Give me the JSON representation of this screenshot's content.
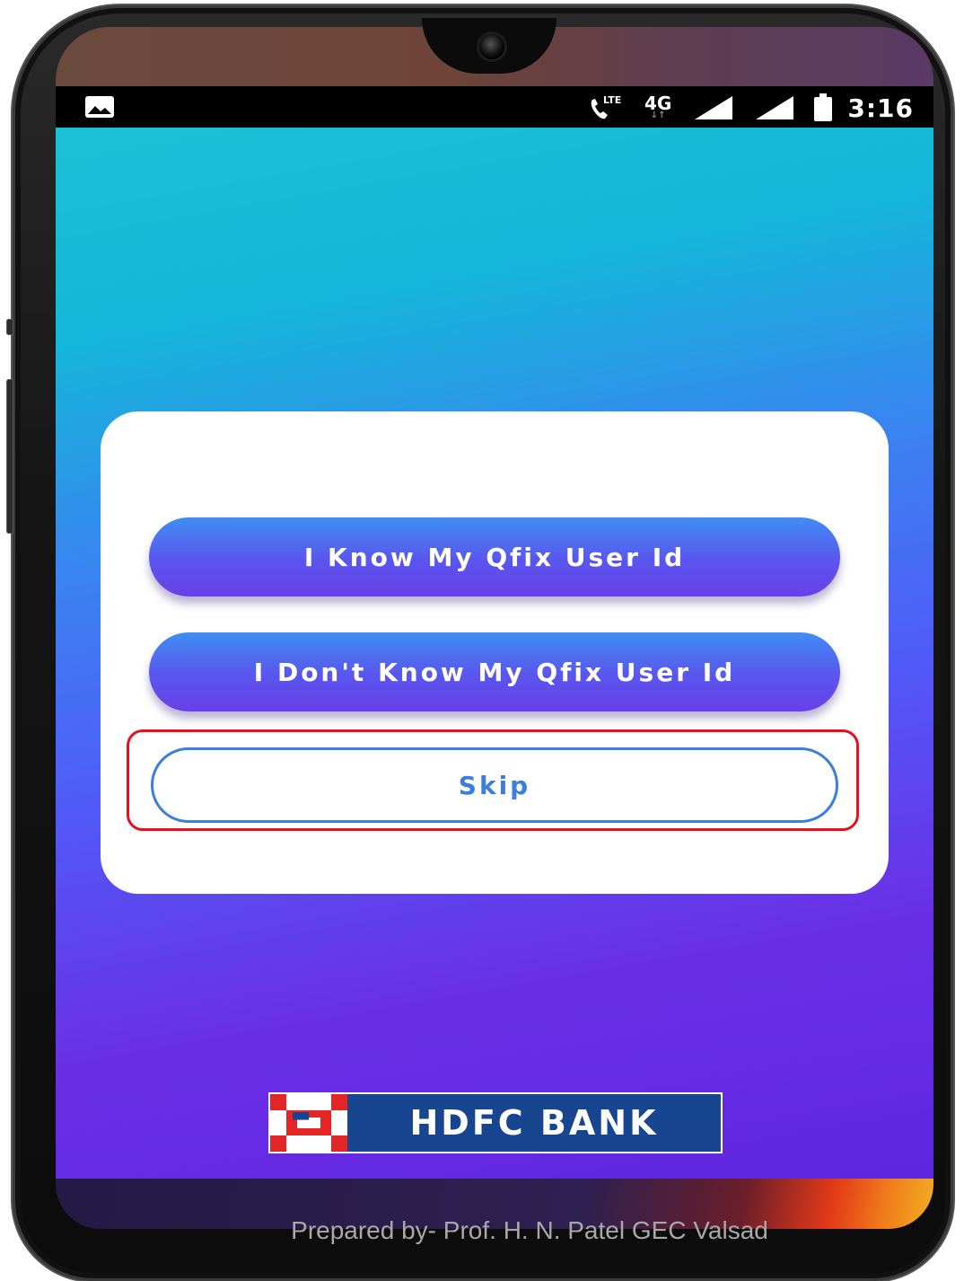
{
  "status_bar": {
    "left_icon": "image-notification-icon",
    "icons": [
      "lte-call-icon",
      "4g-data-icon",
      "signal-icon",
      "signal-icon",
      "battery-icon"
    ],
    "network_call_label": "LTE",
    "network_label": "4G",
    "time": "3:16"
  },
  "dialog": {
    "buttons": [
      {
        "label": "I Know My Qfix User Id"
      },
      {
        "label": "I Don't Know My Qfix User Id"
      },
      {
        "label": "Skip"
      }
    ]
  },
  "footer": {
    "brand_text": "HDFC BANK",
    "brand_colors": {
      "blue": "#17458f",
      "red": "#e32526"
    }
  },
  "caption": "Prepared by- Prof. H. N. Patel GEC Valsad",
  "colors": {
    "button_blue": "#3f8ef5",
    "button_purple": "#6a3fe8",
    "skip_outline": "#3a7ee0",
    "highlight_red": "#e8101a"
  }
}
